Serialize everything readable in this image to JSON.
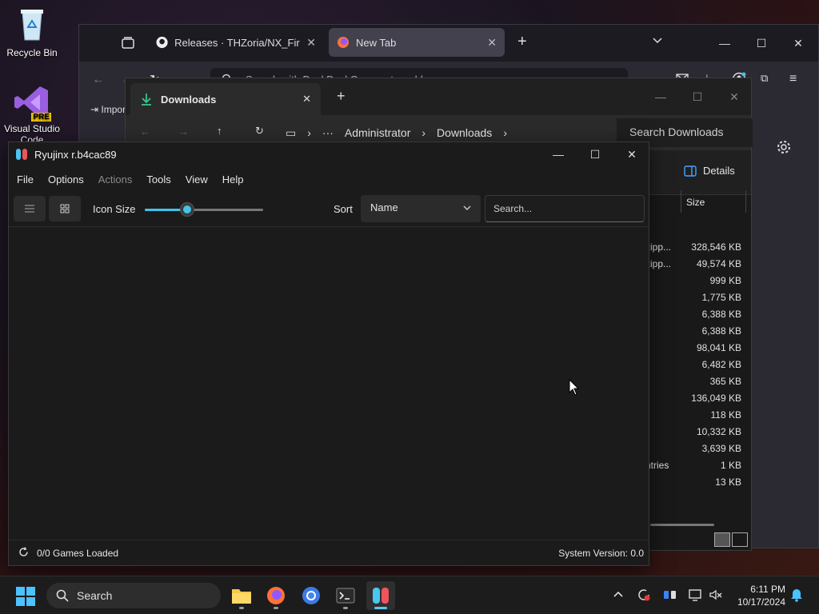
{
  "desktop": {
    "icons": [
      {
        "label": "Recycle Bin"
      },
      {
        "label": "Visual Studio Code",
        "badge": "PRE"
      }
    ]
  },
  "browser": {
    "tabs": [
      {
        "label": "Releases · THZoria/NX_Firmware"
      },
      {
        "label": "New Tab"
      }
    ],
    "address_placeholder": "Search with DuckDuckGo or enter address",
    "bookmark": "Import"
  },
  "explorer": {
    "tab_title": "Downloads",
    "breadcrumb": [
      "Administrator",
      "Downloads"
    ],
    "search_placeholder": "Search Downloads",
    "details_label": "Details",
    "column_size": "Size",
    "rows": [
      {
        "name": "zipp...",
        "size": "328,546 KB"
      },
      {
        "name": "zipp...",
        "size": "49,574 KB"
      },
      {
        "name": "",
        "size": "999 KB"
      },
      {
        "name": "",
        "size": "1,775 KB"
      },
      {
        "name": "",
        "size": "6,388 KB"
      },
      {
        "name": "",
        "size": "6,388 KB"
      },
      {
        "name": "",
        "size": "98,041 KB"
      },
      {
        "name": "",
        "size": "6,482 KB"
      },
      {
        "name": "",
        "size": "365 KB"
      },
      {
        "name": "",
        "size": "136,049 KB"
      },
      {
        "name": "",
        "size": "118 KB"
      },
      {
        "name": "",
        "size": "10,332 KB"
      },
      {
        "name": "",
        "size": "3,639 KB"
      },
      {
        "name": "ntries",
        "size": "1 KB"
      },
      {
        "name": "",
        "size": "13 KB"
      }
    ]
  },
  "ryujinx": {
    "title": "Ryujinx r.b4cac89",
    "menu": {
      "file": "File",
      "options": "Options",
      "actions": "Actions",
      "tools": "Tools",
      "view": "View",
      "help": "Help"
    },
    "icon_size_label": "Icon Size",
    "icon_size_value": 0.36,
    "sort_label": "Sort",
    "sort_value": "Name",
    "search_placeholder": "Search...",
    "games_loaded": "0/0 Games Loaded",
    "system_version": "System Version: 0.0"
  },
  "taskbar": {
    "search_label": "Search",
    "time": "6:11 PM",
    "date": "10/17/2024"
  },
  "colors": {
    "accent": "#40c4ea",
    "window_bg": "#1b1b1b"
  }
}
